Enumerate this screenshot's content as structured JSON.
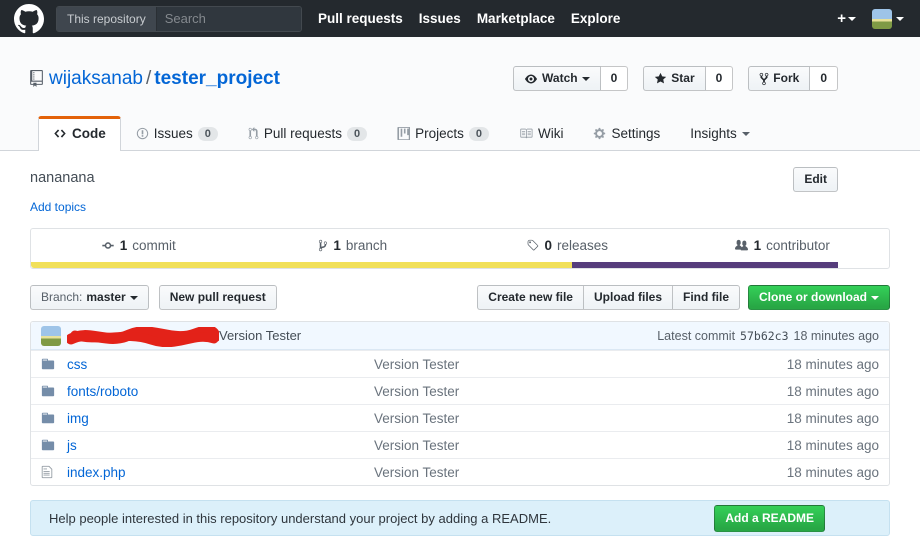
{
  "navbar": {
    "search_scope": "This repository",
    "search_placeholder": "Search",
    "links": [
      {
        "label": "Pull requests"
      },
      {
        "label": "Issues"
      },
      {
        "label": "Marketplace"
      },
      {
        "label": "Explore"
      }
    ]
  },
  "repo": {
    "owner": "wijaksanab",
    "separator": "/",
    "name": "tester_project",
    "watch": {
      "label": "Watch",
      "count": "0"
    },
    "star": {
      "label": "Star",
      "count": "0"
    },
    "fork": {
      "label": "Fork",
      "count": "0"
    }
  },
  "tabs": [
    {
      "label": "Code"
    },
    {
      "label": "Issues",
      "count": "0"
    },
    {
      "label": "Pull requests",
      "count": "0"
    },
    {
      "label": "Projects",
      "count": "0"
    },
    {
      "label": "Wiki"
    },
    {
      "label": "Settings"
    },
    {
      "label": "Insights"
    }
  ],
  "description": {
    "text": "nananana",
    "add_topics": "Add topics",
    "edit_label": "Edit"
  },
  "stats": [
    {
      "value": "1",
      "label": "commit"
    },
    {
      "value": "1",
      "label": "branch"
    },
    {
      "value": "0",
      "label": "releases"
    },
    {
      "value": "1",
      "label": "contributor"
    }
  ],
  "languages": [
    {
      "color": "#f1e05a",
      "percent": 63
    },
    {
      "color": "#563d7c",
      "percent": 31
    }
  ],
  "file_actions": {
    "branch_label": "Branch:",
    "branch_name": "master",
    "new_pull_request": "New pull request",
    "create_new_file": "Create new file",
    "upload_files": "Upload files",
    "find_file": "Find file",
    "clone_or_download": "Clone or download"
  },
  "commit_tease": {
    "message": "Version Tester",
    "latest_prefix": "Latest commit",
    "sha": "57b62c3",
    "time": "18 minutes ago"
  },
  "files": [
    {
      "name": "css",
      "message": "Version Tester",
      "age": "18 minutes ago"
    },
    {
      "name": "fonts/roboto",
      "message": "Version Tester",
      "age": "18 minutes ago"
    },
    {
      "name": "img",
      "message": "Version Tester",
      "age": "18 minutes ago"
    },
    {
      "name": "js",
      "message": "Version Tester",
      "age": "18 minutes ago"
    },
    {
      "name": "index.php",
      "message": "Version Tester",
      "age": "18 minutes ago"
    }
  ],
  "readme_banner": {
    "text": "Help people interested in this repository understand your project by adding a README.",
    "button": "Add a README"
  },
  "colors": {
    "header_bg": "#24292e",
    "link_blue": "#0366d6",
    "active_tab_accent": "#e36209",
    "button_green": "#28a745",
    "language_yellow": "#f1e05a",
    "language_purple": "#563d7c"
  }
}
